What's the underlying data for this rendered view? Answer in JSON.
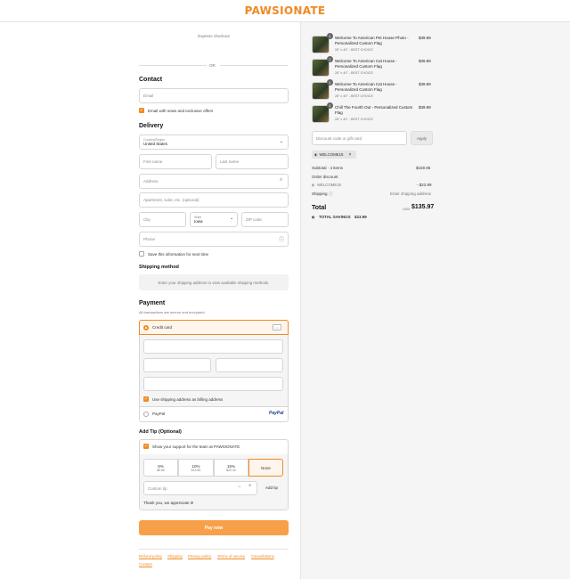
{
  "brand": {
    "name": "PAWSIONATE",
    "color": "#f08a24"
  },
  "express": {
    "title": "Express checkout",
    "or": "OR"
  },
  "contact": {
    "heading": "Contact",
    "email_placeholder": "Email",
    "news_label": "Email with news and exclusive offers",
    "news_checked": true
  },
  "delivery": {
    "heading": "Delivery",
    "country_label": "Country/Region",
    "country_value": "United States",
    "first_name": "First name",
    "last_name": "Last name",
    "address": "Address",
    "apartment": "Apartment, suite, etc. (optional)",
    "city": "City",
    "state_label": "State",
    "state_value": "Iowa",
    "zip": "ZIP code",
    "phone": "Phone",
    "save_info": "Save this information for next time"
  },
  "shipping": {
    "heading": "Shipping method",
    "notice": "Enter your shipping address to view available shipping methods."
  },
  "payment": {
    "heading": "Payment",
    "subtitle": "All transactions are secure and encrypted.",
    "credit_card": "Credit card",
    "billing_same": "Use shipping address as billing address",
    "paypal": "PayPal",
    "paypal_logo": "PayPal"
  },
  "tip": {
    "heading": "Add Tip (Optional)",
    "support_label": "Show your support for the team at PAWSIONATE",
    "options": [
      {
        "pct": "5%",
        "amount": "$6.80"
      },
      {
        "pct": "10%",
        "amount": "$13.60"
      },
      {
        "pct": "15%",
        "amount": "$20.40"
      },
      {
        "pct": "None",
        "amount": ""
      }
    ],
    "custom_placeholder": "Custom tip",
    "add_label": "Add tip",
    "thanks": "Thank you, we appreciate it!"
  },
  "pay_now": "Pay now",
  "footer_links": [
    "Refund policy",
    "Shipping",
    "Privacy policy",
    "Terms of service",
    "Cancellations",
    "Contact"
  ],
  "order": {
    "items": [
      {
        "qty": "1",
        "name": "Welcome To American Pet House Photo - Personalized Custom Flag",
        "variant": "28\" x 40\" - BEST CHOICE",
        "price": "$39.99"
      },
      {
        "qty": "1",
        "name": "Welcome To American Cat House - Personalized Custom Flag",
        "variant": "28\" x 40\" - BEST CHOICE",
        "price": "$39.99"
      },
      {
        "qty": "1",
        "name": "Welcome To American Cat House - Personalized Custom Flag",
        "variant": "28\" x 40\" - BEST CHOICE",
        "price": "$39.99"
      },
      {
        "qty": "1",
        "name": "Chill The Fourth Out - Personalized Custom Flag",
        "variant": "28\" x 40\" - BEST CHOICE",
        "price": "$39.99"
      }
    ],
    "discount_placeholder": "Discount code or gift card",
    "apply": "Apply",
    "applied_code": "WELCOME15",
    "subtotal_label": "Subtotal · 4 items",
    "subtotal": "$159.96",
    "order_discount_label": "Order discount",
    "discount_code": "WELCOME15",
    "discount_amount": "- $23.99",
    "shipping_label": "Shipping",
    "shipping_value": "Enter shipping address",
    "total_label": "Total",
    "currency": "USD",
    "total": "$135.97",
    "savings_label": "TOTAL SAVINGS",
    "savings": "$23.99"
  }
}
